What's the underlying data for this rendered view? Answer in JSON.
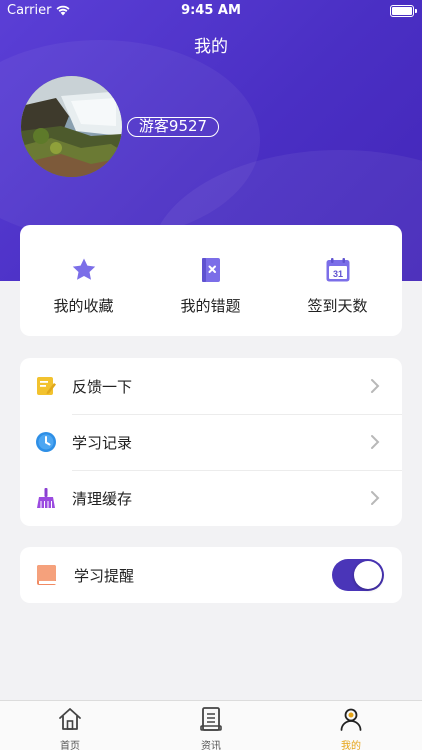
{
  "status_bar": {
    "carrier": "Carrier",
    "time": "9:45 AM"
  },
  "header": {
    "title": "我的"
  },
  "profile": {
    "username": "游客9527"
  },
  "stats": [
    {
      "label": "我的收藏",
      "icon": "star-icon"
    },
    {
      "label": "我的错题",
      "icon": "wrong-notebook-icon"
    },
    {
      "label": "签到天数",
      "icon": "calendar-icon",
      "icon_text": "31"
    }
  ],
  "menu": [
    {
      "label": "反馈一下",
      "icon": "feedback-note-icon"
    },
    {
      "label": "学习记录",
      "icon": "clock-icon"
    },
    {
      "label": "清理缓存",
      "icon": "broom-icon"
    }
  ],
  "reminder": {
    "label": "学习提醒",
    "icon": "book-icon",
    "enabled": true
  },
  "tabs": [
    {
      "label": "首页",
      "icon": "home-icon"
    },
    {
      "label": "资讯",
      "icon": "news-icon"
    },
    {
      "label": "我的",
      "icon": "profile-icon",
      "active": true
    }
  ],
  "colors": {
    "primary": "#4a2fc4",
    "toggle_on": "#4a35b8",
    "tab_active": "#e6a417"
  }
}
